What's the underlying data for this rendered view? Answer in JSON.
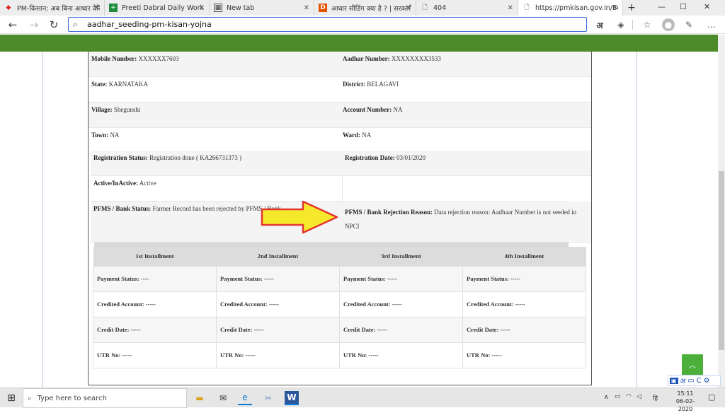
{
  "browser": {
    "tabs": [
      {
        "label": "PM-किसान: अब बिना आधार वैरि",
        "icon": "site-icon",
        "active": false
      },
      {
        "label": "Preeti Dabral Daily Work - G",
        "icon": "sheets-icon",
        "active": false
      },
      {
        "label": "New tab",
        "icon": "newtab-icon",
        "active": false
      },
      {
        "label": "आधार सीडिंग क्या है ? | सरकारी",
        "icon": "d-logo-icon",
        "active": false
      },
      {
        "label": "404",
        "icon": "page-icon",
        "active": false
      },
      {
        "label": "https://pmkisan.gov.in/Bene",
        "icon": "page-icon",
        "active": true
      }
    ],
    "new_tab": "+",
    "address": "aadhar_seeding-pm-kisan-yojna",
    "read_aloud": "अ"
  },
  "details": {
    "mobile_label": "Mobile Number:",
    "mobile_value": "XXXXXX7603",
    "aadhar_label": "Aadhar Number:",
    "aadhar_value": "XXXXXXXX3533",
    "state_label": "State:",
    "state_value": "KARNATAKA",
    "district_label": "District:",
    "district_value": "BELAGAVI",
    "village_label": "Village:",
    "village_value": "Shegunshi",
    "account_label": "Account Number:",
    "account_value": "NA",
    "town_label": "Town:",
    "town_value": "NA",
    "ward_label": "Ward:",
    "ward_value": "NA",
    "reg_status_label": "Registration Status:",
    "reg_status_value": "Registration done ( KA266731373 )",
    "reg_date_label": "Registration Date:",
    "reg_date_value": "03/01/2020",
    "active_label": "Active/InActive:",
    "active_value": "Active",
    "pfms_label": "PFMS / Bank Status:",
    "pfms_value": "Farmer Record has been rejected by PFMS / Bank",
    "rejection_label": "PFMS / Bank Rejection Reason:",
    "rejection_value": "Data rejection reason: Aadhaar Number is not seeded in NPCI"
  },
  "installments": {
    "headers": [
      "1st Installment",
      "2nd Installment",
      "3rd Installment",
      "4th Installment"
    ],
    "rows": [
      [
        "Payment Status: ----",
        "Payment Status: -----",
        "Payment Status: -----",
        "Payment Status: -----"
      ],
      [
        "Credited Account: -----",
        "Credited Account: -----",
        "Credited Account: -----",
        "Credited Account: -----"
      ],
      [
        "Credit Date: -----",
        "Credit Date: -----",
        "Credit Date: -----",
        "Credit Date: -----"
      ],
      [
        "UTR No: -----",
        "UTR No: -----",
        "UTR No: -----",
        "UTR No: -----"
      ]
    ]
  },
  "ime": {
    "hindi": "अ",
    "c": "C"
  },
  "taskbar": {
    "search_placeholder": "Type here to search",
    "time": "15:11",
    "date": "06-02-2020",
    "lang": "हि"
  },
  "colors": {
    "green_bar": "#4d8a2a",
    "arrow_fill": "#f6e82b",
    "arrow_stroke": "#e3342f"
  }
}
